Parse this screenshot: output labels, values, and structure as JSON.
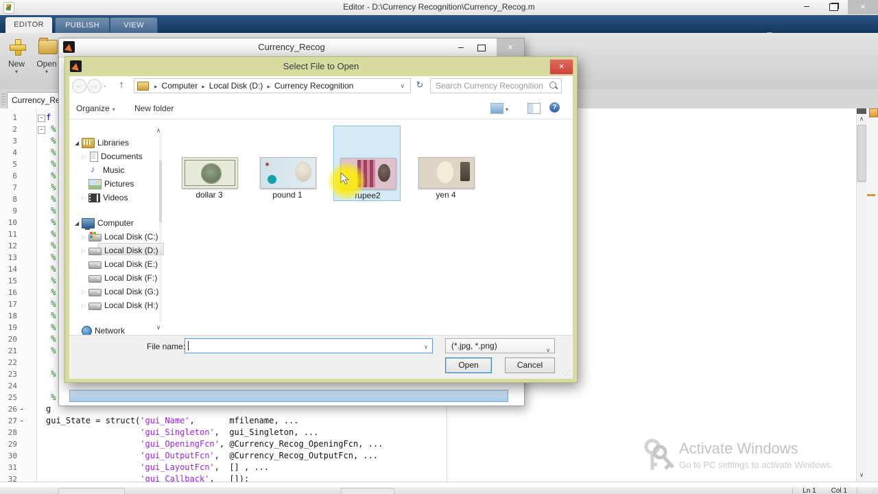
{
  "titlebar": {
    "title": "Editor - D:\\Currency Recognition\\Currency_Recog.m"
  },
  "ribbon": {
    "tabs": [
      {
        "label": "EDITOR",
        "active": true
      },
      {
        "label": "PUBLISH",
        "active": false
      },
      {
        "label": "VIEW",
        "active": false
      }
    ],
    "buttons": [
      {
        "label": "New",
        "icon": "new-plus-icon"
      },
      {
        "label": "Open",
        "icon": "open-folder-icon"
      }
    ],
    "quick_icons": [
      {
        "name": "new-script",
        "enabled": true
      },
      {
        "name": "save",
        "enabled": true
      },
      {
        "name": "cut",
        "enabled": false
      },
      {
        "name": "copy",
        "enabled": false
      },
      {
        "name": "paste",
        "enabled": true
      },
      {
        "name": "undo",
        "enabled": false
      },
      {
        "name": "redo",
        "enabled": false
      },
      {
        "name": "switch-windows",
        "enabled": true
      },
      {
        "name": "help",
        "enabled": true
      },
      {
        "name": "circle-caret",
        "enabled": true
      },
      {
        "name": "collapse",
        "enabled": true
      }
    ]
  },
  "editor": {
    "doc_tab": "Currency_Re",
    "status": {
      "ln": "Ln 1",
      "col": "Col 1"
    },
    "lines": [
      {
        "n": 1,
        "fold": "−",
        "code": [
          [
            "f",
            "kw"
          ]
        ]
      },
      {
        "n": 2,
        "fold": "−",
        "code": [
          [
            " %",
            "cm"
          ]
        ]
      },
      {
        "n": 3,
        "code": [
          [
            " %",
            "cm"
          ]
        ]
      },
      {
        "n": 4,
        "code": [
          [
            " %",
            "cm"
          ]
        ]
      },
      {
        "n": 5,
        "code": [
          [
            " %",
            "cm"
          ]
        ]
      },
      {
        "n": 6,
        "code": [
          [
            " %",
            "cm"
          ]
        ]
      },
      {
        "n": 7,
        "code": [
          [
            " %",
            "cm"
          ]
        ]
      },
      {
        "n": 8,
        "code": [
          [
            " %",
            "cm"
          ]
        ]
      },
      {
        "n": 9,
        "code": [
          [
            " %",
            "cm"
          ]
        ]
      },
      {
        "n": 10,
        "code": [
          [
            " %",
            "cm"
          ]
        ]
      },
      {
        "n": 11,
        "code": [
          [
            " %",
            "cm"
          ]
        ]
      },
      {
        "n": 12,
        "code": [
          [
            " %",
            "cm"
          ]
        ]
      },
      {
        "n": 13,
        "code": [
          [
            " %",
            "cm"
          ]
        ]
      },
      {
        "n": 14,
        "code": [
          [
            " %",
            "cm"
          ]
        ]
      },
      {
        "n": 15,
        "code": [
          [
            " %",
            "cm"
          ]
        ]
      },
      {
        "n": 16,
        "code": [
          [
            " %",
            "cm"
          ]
        ]
      },
      {
        "n": 17,
        "code": [
          [
            " %",
            "cm"
          ]
        ]
      },
      {
        "n": 18,
        "code": [
          [
            " %",
            "cm"
          ]
        ]
      },
      {
        "n": 19,
        "code": [
          [
            " %",
            "cm"
          ]
        ]
      },
      {
        "n": 20,
        "code": [
          [
            " %",
            "cm"
          ]
        ]
      },
      {
        "n": 21,
        "code": [
          [
            " %",
            "cm"
          ]
        ]
      },
      {
        "n": 22,
        "code": []
      },
      {
        "n": 23,
        "code": [
          [
            " %",
            "cm"
          ]
        ]
      },
      {
        "n": 24,
        "code": []
      },
      {
        "n": 25,
        "code": [
          [
            " %",
            "cm"
          ]
        ]
      },
      {
        "n": 26,
        "mark": "-",
        "code": [
          [
            "g",
            "pl"
          ]
        ]
      },
      {
        "n": 27,
        "mark": "-",
        "code": [
          [
            "gui_State = struct(",
            "pl"
          ],
          [
            "'gui_Name'",
            "st"
          ],
          [
            ",       mfilename, ...",
            "pl"
          ]
        ]
      },
      {
        "n": 28,
        "code": [
          [
            "                   ",
            "pl"
          ],
          [
            "'gui_Singleton'",
            "st"
          ],
          [
            ",  gui_Singleton, ...",
            "pl"
          ]
        ]
      },
      {
        "n": 29,
        "code": [
          [
            "                   ",
            "pl"
          ],
          [
            "'gui_OpeningFcn'",
            "st"
          ],
          [
            ", @Currency_Recog_OpeningFcn, ...",
            "pl"
          ]
        ]
      },
      {
        "n": 30,
        "code": [
          [
            "                   ",
            "pl"
          ],
          [
            "'gui_OutputFcn'",
            "st"
          ],
          [
            ",  @Currency_Recog_OutputFcn, ...",
            "pl"
          ]
        ]
      },
      {
        "n": 31,
        "code": [
          [
            "                   ",
            "pl"
          ],
          [
            "'gui_LayoutFcn'",
            "st"
          ],
          [
            ",  [] , ...",
            "pl"
          ]
        ]
      },
      {
        "n": 32,
        "code": [
          [
            "                   ",
            "pl"
          ],
          [
            "'gui_Callback'",
            "st"
          ],
          [
            ",   []);",
            "pl"
          ]
        ]
      }
    ]
  },
  "figure_window": {
    "title": "Currency_Recog"
  },
  "dialog": {
    "title": "Select File to Open",
    "breadcrumb": {
      "items": [
        "Computer",
        "Local Disk (D:)",
        "Currency Recognition"
      ]
    },
    "search": {
      "placeholder": "Search Currency Recognition"
    },
    "toolbar": {
      "organize": "Organize",
      "new_folder": "New folder"
    },
    "nav": [
      {
        "label": "Libraries",
        "icon": "libraries",
        "indent": 0,
        "expander": "open",
        "selected": false,
        "gap": 0
      },
      {
        "label": "Documents",
        "icon": "document",
        "indent": 1,
        "expander": "closed",
        "selected": false,
        "gap": 0
      },
      {
        "label": "Music",
        "icon": "music",
        "indent": 1,
        "expander": "none",
        "selected": false,
        "gap": 0
      },
      {
        "label": "Pictures",
        "icon": "picture",
        "indent": 1,
        "expander": "none",
        "selected": false,
        "gap": 0
      },
      {
        "label": "Videos",
        "icon": "video",
        "indent": 1,
        "expander": "closed",
        "selected": false,
        "gap": 0
      },
      {
        "label": "Computer",
        "icon": "computer",
        "indent": 0,
        "expander": "open",
        "selected": false,
        "gap": 17
      },
      {
        "label": "Local Disk (C:)",
        "icon": "disk-os",
        "indent": 1,
        "expander": "closed",
        "selected": false,
        "gap": 0
      },
      {
        "label": "Local Disk (D:)",
        "icon": "disk",
        "indent": 1,
        "expander": "closed",
        "selected": true,
        "gap": 0
      },
      {
        "label": "Local Disk (E:)",
        "icon": "disk",
        "indent": 1,
        "expander": "none",
        "selected": false,
        "gap": 0
      },
      {
        "label": "Local Disk (F:)",
        "icon": "disk",
        "indent": 1,
        "expander": "none",
        "selected": false,
        "gap": 0
      },
      {
        "label": "Local Disk (G:)",
        "icon": "disk",
        "indent": 1,
        "expander": "closed",
        "selected": false,
        "gap": 0
      },
      {
        "label": "Local Disk (H:)",
        "icon": "disk",
        "indent": 1,
        "expander": "closed",
        "selected": false,
        "gap": 0
      },
      {
        "label": "Network",
        "icon": "network",
        "indent": 0,
        "expander": "none",
        "selected": false,
        "gap": 17
      }
    ],
    "files": [
      {
        "label": "dollar 3",
        "kind": "dollar",
        "selected": false
      },
      {
        "label": "pound 1",
        "kind": "pound",
        "selected": false
      },
      {
        "label": "rupee2",
        "kind": "rupee",
        "selected": true
      },
      {
        "label": "yen 4",
        "kind": "yen",
        "selected": false
      }
    ],
    "footer": {
      "file_name_label": "File name:",
      "file_name_value": "",
      "file_type": "(*.jpg, *.png)",
      "open": "Open",
      "cancel": "Cancel"
    }
  },
  "watermark": {
    "line1": "Activate Windows",
    "line2": "Go to PC settings to activate Windows."
  },
  "colors": {
    "dialog_chrome": "#d7db9f",
    "selection_blue": "#d5eaf7",
    "close_red": "#d0392c",
    "tab_bar_navy": "#16375c",
    "code_string": "#a020f0",
    "code_comment": "#228b22",
    "code_keyword": "#0000ff"
  }
}
